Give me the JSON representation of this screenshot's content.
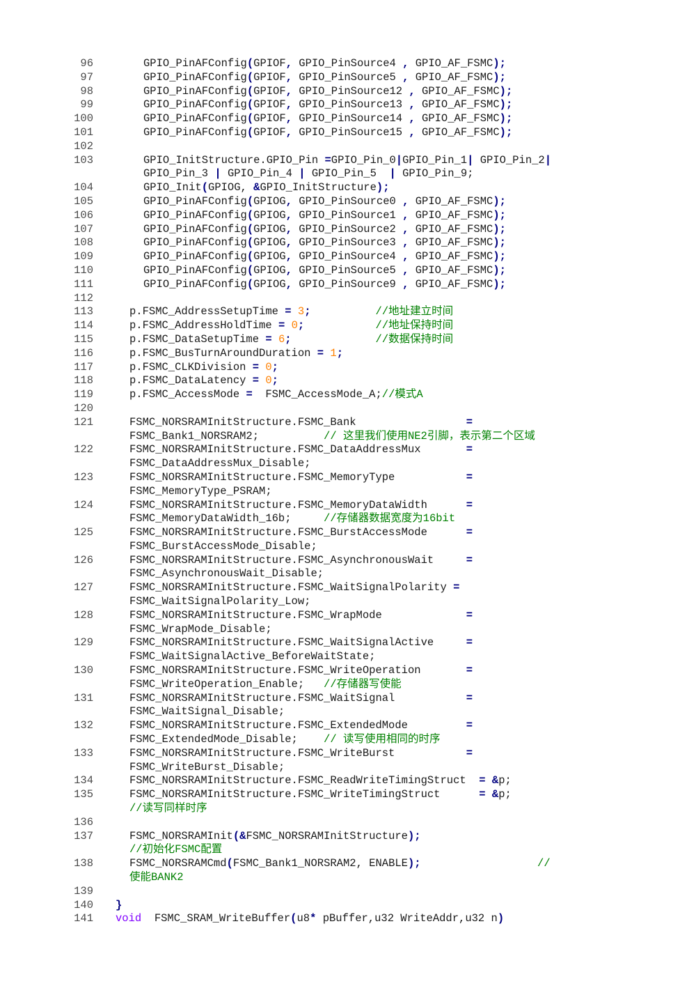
{
  "colors": {
    "text": "#1a1a1a",
    "line_number": "#4a4a4a",
    "operator": "#000080",
    "number": "#ff8000",
    "comment": "#008000",
    "keyword": "#8000ff"
  },
  "lines": [
    {
      "n": "96",
      "indent": 4,
      "segs": [
        {
          "t": "GPIO_PinAFConfig"
        },
        {
          "t": "(",
          "c": "op"
        },
        {
          "t": "GPIOF"
        },
        {
          "t": ",",
          "c": "op"
        },
        {
          "t": " GPIO_PinSource4 "
        },
        {
          "t": ",",
          "c": "op"
        },
        {
          "t": " GPIO_AF_FSMC"
        },
        {
          "t": ");",
          "c": "op"
        }
      ]
    },
    {
      "n": "97",
      "indent": 4,
      "segs": [
        {
          "t": "GPIO_PinAFConfig"
        },
        {
          "t": "(",
          "c": "op"
        },
        {
          "t": "GPIOF"
        },
        {
          "t": ",",
          "c": "op"
        },
        {
          "t": " GPIO_PinSource5 "
        },
        {
          "t": ",",
          "c": "op"
        },
        {
          "t": " GPIO_AF_FSMC"
        },
        {
          "t": ");",
          "c": "op"
        }
      ]
    },
    {
      "n": "98",
      "indent": 4,
      "segs": [
        {
          "t": "GPIO_PinAFConfig"
        },
        {
          "t": "(",
          "c": "op"
        },
        {
          "t": "GPIOF"
        },
        {
          "t": ",",
          "c": "op"
        },
        {
          "t": " GPIO_PinSource12 "
        },
        {
          "t": ",",
          "c": "op"
        },
        {
          "t": " GPIO_AF_FSMC"
        },
        {
          "t": ");",
          "c": "op"
        }
      ]
    },
    {
      "n": "99",
      "indent": 4,
      "segs": [
        {
          "t": "GPIO_PinAFConfig"
        },
        {
          "t": "(",
          "c": "op"
        },
        {
          "t": "GPIOF"
        },
        {
          "t": ",",
          "c": "op"
        },
        {
          "t": " GPIO_PinSource13 "
        },
        {
          "t": ",",
          "c": "op"
        },
        {
          "t": " GPIO_AF_FSMC"
        },
        {
          "t": ");",
          "c": "op"
        }
      ]
    },
    {
      "n": "100",
      "indent": 4,
      "segs": [
        {
          "t": "GPIO_PinAFConfig"
        },
        {
          "t": "(",
          "c": "op"
        },
        {
          "t": "GPIOF"
        },
        {
          "t": ",",
          "c": "op"
        },
        {
          "t": " GPIO_PinSource14 "
        },
        {
          "t": ",",
          "c": "op"
        },
        {
          "t": " GPIO_AF_FSMC"
        },
        {
          "t": ");",
          "c": "op"
        }
      ]
    },
    {
      "n": "101",
      "indent": 4,
      "segs": [
        {
          "t": "GPIO_PinAFConfig"
        },
        {
          "t": "(",
          "c": "op"
        },
        {
          "t": "GPIOF"
        },
        {
          "t": ",",
          "c": "op"
        },
        {
          "t": " GPIO_PinSource15 "
        },
        {
          "t": ",",
          "c": "op"
        },
        {
          "t": " GPIO_AF_FSMC"
        },
        {
          "t": ");",
          "c": "op"
        }
      ]
    },
    {
      "n": "102",
      "indent": 0,
      "segs": []
    },
    {
      "n": "103",
      "indent": 4,
      "segs": [
        {
          "t": "GPIO_InitStructure.GPIO_Pin "
        },
        {
          "t": "=",
          "c": "op"
        },
        {
          "t": "GPIO_Pin_0"
        },
        {
          "t": "|",
          "c": "op"
        },
        {
          "t": "GPIO_Pin_1"
        },
        {
          "t": "|",
          "c": "op"
        },
        {
          "t": " GPIO_Pin_2"
        },
        {
          "t": "|",
          "c": "op"
        }
      ]
    },
    {
      "n": "",
      "indent": 4,
      "segs": [
        {
          "t": "GPIO_Pin_3 "
        },
        {
          "t": "|",
          "c": "op"
        },
        {
          "t": " GPIO_Pin_4 "
        },
        {
          "t": "|",
          "c": "op"
        },
        {
          "t": " GPIO_Pin_5  "
        },
        {
          "t": "|",
          "c": "op"
        },
        {
          "t": " GPIO_Pin_9;"
        }
      ]
    },
    {
      "n": "104",
      "indent": 4,
      "segs": [
        {
          "t": "GPIO_Init"
        },
        {
          "t": "(",
          "c": "op"
        },
        {
          "t": "GPIOG, "
        },
        {
          "t": "&",
          "c": "op"
        },
        {
          "t": "GPIO_InitStructure"
        },
        {
          "t": ");",
          "c": "op"
        }
      ]
    },
    {
      "n": "105",
      "indent": 4,
      "segs": [
        {
          "t": "GPIO_PinAFConfig"
        },
        {
          "t": "(",
          "c": "op"
        },
        {
          "t": "GPIOG"
        },
        {
          "t": ",",
          "c": "op"
        },
        {
          "t": " GPIO_PinSource0 "
        },
        {
          "t": ",",
          "c": "op"
        },
        {
          "t": " GPIO_AF_FSMC"
        },
        {
          "t": ");",
          "c": "op"
        }
      ]
    },
    {
      "n": "106",
      "indent": 4,
      "segs": [
        {
          "t": "GPIO_PinAFConfig"
        },
        {
          "t": "(",
          "c": "op"
        },
        {
          "t": "GPIOG"
        },
        {
          "t": ",",
          "c": "op"
        },
        {
          "t": " GPIO_PinSource1 "
        },
        {
          "t": ",",
          "c": "op"
        },
        {
          "t": " GPIO_AF_FSMC"
        },
        {
          "t": ");",
          "c": "op"
        }
      ]
    },
    {
      "n": "107",
      "indent": 4,
      "segs": [
        {
          "t": "GPIO_PinAFConfig"
        },
        {
          "t": "(",
          "c": "op"
        },
        {
          "t": "GPIOG"
        },
        {
          "t": ",",
          "c": "op"
        },
        {
          "t": " GPIO_PinSource2 "
        },
        {
          "t": ",",
          "c": "op"
        },
        {
          "t": " GPIO_AF_FSMC"
        },
        {
          "t": ");",
          "c": "op"
        }
      ]
    },
    {
      "n": "108",
      "indent": 4,
      "segs": [
        {
          "t": "GPIO_PinAFConfig"
        },
        {
          "t": "(",
          "c": "op"
        },
        {
          "t": "GPIOG"
        },
        {
          "t": ",",
          "c": "op"
        },
        {
          "t": " GPIO_PinSource3 "
        },
        {
          "t": ",",
          "c": "op"
        },
        {
          "t": " GPIO_AF_FSMC"
        },
        {
          "t": ");",
          "c": "op"
        }
      ]
    },
    {
      "n": "109",
      "indent": 4,
      "segs": [
        {
          "t": "GPIO_PinAFConfig"
        },
        {
          "t": "(",
          "c": "op"
        },
        {
          "t": "GPIOG"
        },
        {
          "t": ",",
          "c": "op"
        },
        {
          "t": " GPIO_PinSource4 "
        },
        {
          "t": ",",
          "c": "op"
        },
        {
          "t": " GPIO_AF_FSMC"
        },
        {
          "t": ");",
          "c": "op"
        }
      ]
    },
    {
      "n": "110",
      "indent": 4,
      "segs": [
        {
          "t": "GPIO_PinAFConfig"
        },
        {
          "t": "(",
          "c": "op"
        },
        {
          "t": "GPIOG"
        },
        {
          "t": ",",
          "c": "op"
        },
        {
          "t": " GPIO_PinSource5 "
        },
        {
          "t": ",",
          "c": "op"
        },
        {
          "t": " GPIO_AF_FSMC"
        },
        {
          "t": ");",
          "c": "op"
        }
      ]
    },
    {
      "n": "111",
      "indent": 4,
      "segs": [
        {
          "t": "GPIO_PinAFConfig"
        },
        {
          "t": "(",
          "c": "op"
        },
        {
          "t": "GPIOG"
        },
        {
          "t": ",",
          "c": "op"
        },
        {
          "t": " GPIO_PinSource9 "
        },
        {
          "t": ",",
          "c": "op"
        },
        {
          "t": " GPIO_AF_FSMC"
        },
        {
          "t": ");",
          "c": "op"
        }
      ]
    },
    {
      "n": "112",
      "indent": 0,
      "segs": []
    },
    {
      "n": "113",
      "indent": 2,
      "segs": [
        {
          "t": "p.FSMC_AddressSetupTime "
        },
        {
          "t": "=",
          "c": "op"
        },
        {
          "t": " "
        },
        {
          "t": "3",
          "c": "num"
        },
        {
          "t": ";",
          "c": "op"
        },
        {
          "t": "          "
        },
        {
          "t": "//地址建立时间",
          "c": "cm"
        }
      ]
    },
    {
      "n": "114",
      "indent": 2,
      "segs": [
        {
          "t": "p.FSMC_AddressHoldTime "
        },
        {
          "t": "=",
          "c": "op"
        },
        {
          "t": " "
        },
        {
          "t": "0",
          "c": "num"
        },
        {
          "t": ";",
          "c": "op"
        },
        {
          "t": "           "
        },
        {
          "t": "//地址保持时间",
          "c": "cm"
        }
      ]
    },
    {
      "n": "115",
      "indent": 2,
      "segs": [
        {
          "t": "p.FSMC_DataSetupTime "
        },
        {
          "t": "=",
          "c": "op"
        },
        {
          "t": " "
        },
        {
          "t": "6",
          "c": "num"
        },
        {
          "t": ";",
          "c": "op"
        },
        {
          "t": "             "
        },
        {
          "t": "//数据保持时间",
          "c": "cm"
        }
      ]
    },
    {
      "n": "116",
      "indent": 2,
      "segs": [
        {
          "t": "p.FSMC_BusTurnAroundDuration "
        },
        {
          "t": "=",
          "c": "op"
        },
        {
          "t": " "
        },
        {
          "t": "1",
          "c": "num"
        },
        {
          "t": ";",
          "c": "op"
        }
      ]
    },
    {
      "n": "117",
      "indent": 2,
      "segs": [
        {
          "t": "p.FSMC_CLKDivision "
        },
        {
          "t": "=",
          "c": "op"
        },
        {
          "t": " "
        },
        {
          "t": "0",
          "c": "num"
        },
        {
          "t": ";",
          "c": "op"
        }
      ]
    },
    {
      "n": "118",
      "indent": 2,
      "segs": [
        {
          "t": "p.FSMC_DataLatency "
        },
        {
          "t": "=",
          "c": "op"
        },
        {
          "t": " "
        },
        {
          "t": "0",
          "c": "num"
        },
        {
          "t": ";",
          "c": "op"
        }
      ]
    },
    {
      "n": "119",
      "indent": 2,
      "segs": [
        {
          "t": "p.FSMC_AccessMode "
        },
        {
          "t": "=",
          "c": "op"
        },
        {
          "t": "  FSMC_AccessMode_A;"
        },
        {
          "t": "//模式A",
          "c": "cm"
        }
      ]
    },
    {
      "n": "120",
      "indent": 0,
      "segs": []
    },
    {
      "n": "121",
      "indent": 2,
      "segs": [
        {
          "t": "FSMC_NORSRAMInitStructure.FSMC_Bank                 "
        },
        {
          "t": "=",
          "c": "op"
        }
      ]
    },
    {
      "n": "",
      "indent": 2,
      "segs": [
        {
          "t": "FSMC_Bank1_NORSRAM2;          "
        },
        {
          "t": "// 这里我们使用NE2引脚，表示第二个区域",
          "c": "cm"
        }
      ]
    },
    {
      "n": "122",
      "indent": 2,
      "segs": [
        {
          "t": "FSMC_NORSRAMInitStructure.FSMC_DataAddressMux       "
        },
        {
          "t": "=",
          "c": "op"
        }
      ]
    },
    {
      "n": "",
      "indent": 2,
      "segs": [
        {
          "t": "FSMC_DataAddressMux_Disable;"
        }
      ]
    },
    {
      "n": "123",
      "indent": 2,
      "segs": [
        {
          "t": "FSMC_NORSRAMInitStructure.FSMC_MemoryType           "
        },
        {
          "t": "=",
          "c": "op"
        }
      ]
    },
    {
      "n": "",
      "indent": 2,
      "segs": [
        {
          "t": "FSMC_MemoryType_PSRAM;"
        }
      ]
    },
    {
      "n": "124",
      "indent": 2,
      "segs": [
        {
          "t": "FSMC_NORSRAMInitStructure.FSMC_MemoryDataWidth      "
        },
        {
          "t": "=",
          "c": "op"
        }
      ]
    },
    {
      "n": "",
      "indent": 2,
      "segs": [
        {
          "t": "FSMC_MemoryDataWidth_16b;     "
        },
        {
          "t": "//存储器数据宽度为16bit",
          "c": "cm"
        }
      ]
    },
    {
      "n": "125",
      "indent": 2,
      "segs": [
        {
          "t": "FSMC_NORSRAMInitStructure.FSMC_BurstAccessMode      "
        },
        {
          "t": "=",
          "c": "op"
        }
      ]
    },
    {
      "n": "",
      "indent": 2,
      "segs": [
        {
          "t": "FSMC_BurstAccessMode_Disable;"
        }
      ]
    },
    {
      "n": "126",
      "indent": 2,
      "segs": [
        {
          "t": "FSMC_NORSRAMInitStructure.FSMC_AsynchronousWait     "
        },
        {
          "t": "=",
          "c": "op"
        }
      ]
    },
    {
      "n": "",
      "indent": 2,
      "segs": [
        {
          "t": "FSMC_AsynchronousWait_Disable;"
        }
      ]
    },
    {
      "n": "127",
      "indent": 2,
      "segs": [
        {
          "t": "FSMC_NORSRAMInitStructure.FSMC_WaitSignalPolarity "
        },
        {
          "t": "=",
          "c": "op"
        }
      ]
    },
    {
      "n": "",
      "indent": 2,
      "segs": [
        {
          "t": "FSMC_WaitSignalPolarity_Low;"
        }
      ]
    },
    {
      "n": "128",
      "indent": 2,
      "segs": [
        {
          "t": "FSMC_NORSRAMInitStructure.FSMC_WrapMode             "
        },
        {
          "t": "=",
          "c": "op"
        }
      ]
    },
    {
      "n": "",
      "indent": 2,
      "segs": [
        {
          "t": "FSMC_WrapMode_Disable;"
        }
      ]
    },
    {
      "n": "129",
      "indent": 2,
      "segs": [
        {
          "t": "FSMC_NORSRAMInitStructure.FSMC_WaitSignalActive     "
        },
        {
          "t": "=",
          "c": "op"
        }
      ]
    },
    {
      "n": "",
      "indent": 2,
      "segs": [
        {
          "t": "FSMC_WaitSignalActive_BeforeWaitState;"
        }
      ]
    },
    {
      "n": "130",
      "indent": 2,
      "segs": [
        {
          "t": "FSMC_NORSRAMInitStructure.FSMC_WriteOperation       "
        },
        {
          "t": "=",
          "c": "op"
        }
      ]
    },
    {
      "n": "",
      "indent": 2,
      "segs": [
        {
          "t": "FSMC_WriteOperation_Enable;   "
        },
        {
          "t": "//存储器写使能",
          "c": "cm"
        }
      ]
    },
    {
      "n": "131",
      "indent": 2,
      "segs": [
        {
          "t": "FSMC_NORSRAMInitStructure.FSMC_WaitSignal           "
        },
        {
          "t": "=",
          "c": "op"
        }
      ]
    },
    {
      "n": "",
      "indent": 2,
      "segs": [
        {
          "t": "FSMC_WaitSignal_Disable;"
        }
      ]
    },
    {
      "n": "132",
      "indent": 2,
      "segs": [
        {
          "t": "FSMC_NORSRAMInitStructure.FSMC_ExtendedMode         "
        },
        {
          "t": "=",
          "c": "op"
        }
      ]
    },
    {
      "n": "",
      "indent": 2,
      "segs": [
        {
          "t": "FSMC_ExtendedMode_Disable;    "
        },
        {
          "t": "// 读写使用相同的时序",
          "c": "cm"
        }
      ]
    },
    {
      "n": "133",
      "indent": 2,
      "segs": [
        {
          "t": "FSMC_NORSRAMInitStructure.FSMC_WriteBurst           "
        },
        {
          "t": "=",
          "c": "op"
        }
      ]
    },
    {
      "n": "",
      "indent": 2,
      "segs": [
        {
          "t": "FSMC_WriteBurst_Disable;"
        }
      ]
    },
    {
      "n": "134",
      "indent": 2,
      "segs": [
        {
          "t": "FSMC_NORSRAMInitStructure.FSMC_ReadWriteTimingStruct  "
        },
        {
          "t": "=",
          "c": "op"
        },
        {
          "t": " "
        },
        {
          "t": "&",
          "c": "op"
        },
        {
          "t": "p;"
        }
      ]
    },
    {
      "n": "135",
      "indent": 2,
      "segs": [
        {
          "t": "FSMC_NORSRAMInitStructure.FSMC_WriteTimingStruct      "
        },
        {
          "t": "=",
          "c": "op"
        },
        {
          "t": " "
        },
        {
          "t": "&",
          "c": "op"
        },
        {
          "t": "p;"
        }
      ]
    },
    {
      "n": "",
      "indent": 2,
      "segs": [
        {
          "t": "//读写同样时序",
          "c": "cm"
        }
      ]
    },
    {
      "n": "136",
      "indent": 0,
      "segs": []
    },
    {
      "n": "137",
      "indent": 2,
      "segs": [
        {
          "t": "FSMC_NORSRAMInit"
        },
        {
          "t": "(&",
          "c": "op"
        },
        {
          "t": "FSMC_NORSRAMInitStructure"
        },
        {
          "t": ");",
          "c": "op"
        }
      ]
    },
    {
      "n": "",
      "indent": 2,
      "segs": [
        {
          "t": "//初始化FSMC配置",
          "c": "cm"
        }
      ]
    },
    {
      "n": "138",
      "indent": 2,
      "segs": [
        {
          "t": "FSMC_NORSRAMCmd"
        },
        {
          "t": "(",
          "c": "op"
        },
        {
          "t": "FSMC_Bank1_NORSRAM2, ENABLE"
        },
        {
          "t": ");",
          "c": "op"
        },
        {
          "t": "                  "
        },
        {
          "t": "//",
          "c": "cm"
        }
      ]
    },
    {
      "n": "",
      "indent": 2,
      "segs": [
        {
          "t": "使能BANK2",
          "c": "cm"
        }
      ]
    },
    {
      "n": "139",
      "indent": 0,
      "segs": []
    },
    {
      "n": "140",
      "indent": 0,
      "segs": [
        {
          "t": "}",
          "c": "op"
        }
      ]
    },
    {
      "n": "141",
      "indent": 0,
      "segs": [
        {
          "t": "void",
          "c": "kw"
        },
        {
          "t": "  FSMC_SRAM_WriteBuffer"
        },
        {
          "t": "(",
          "c": "op"
        },
        {
          "t": "u8"
        },
        {
          "t": "*",
          "c": "op"
        },
        {
          "t": " pBuffer,u32 WriteAddr,u32 n"
        },
        {
          "t": ")",
          "c": "op"
        }
      ]
    }
  ]
}
